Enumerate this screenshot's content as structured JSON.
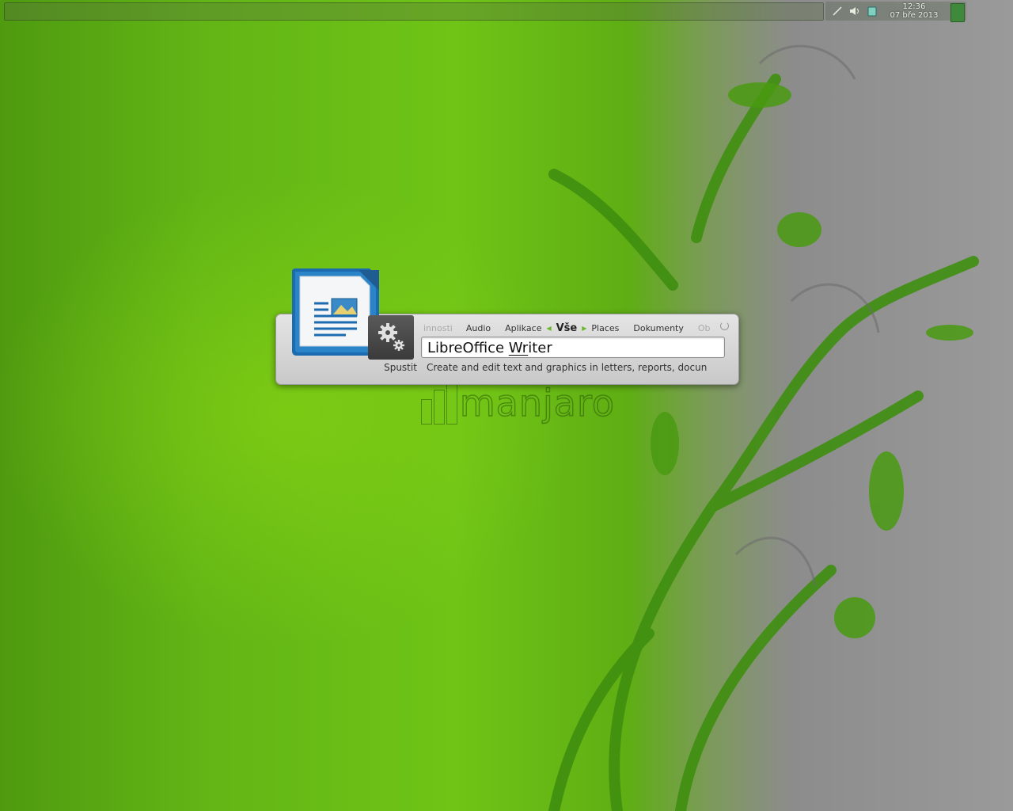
{
  "panel": {
    "tray_icons": [
      "network-icon",
      "volume-icon",
      "clipboard-icon"
    ],
    "clock_time": "12:36",
    "clock_date": "07 bře 2013"
  },
  "wallpaper": {
    "watermark_text": "manjaro"
  },
  "runner": {
    "tabs": [
      "innosti",
      "Audio",
      "Aplikace",
      "Vše",
      "Places",
      "Dokumenty",
      "Ob"
    ],
    "active_tab": "Vše",
    "query_prefix": "LibreOffice ",
    "query_match": "Wr",
    "query_suffix": "iter",
    "run_label": "Spustit",
    "description": "Create and edit text and graphics in letters, reports, docun",
    "app_icon": "libreoffice-writer-icon",
    "settings_icon": "gear-icon"
  },
  "colors": {
    "accent": "#6ab82a",
    "dialog_bg": "#d8d8d8"
  }
}
